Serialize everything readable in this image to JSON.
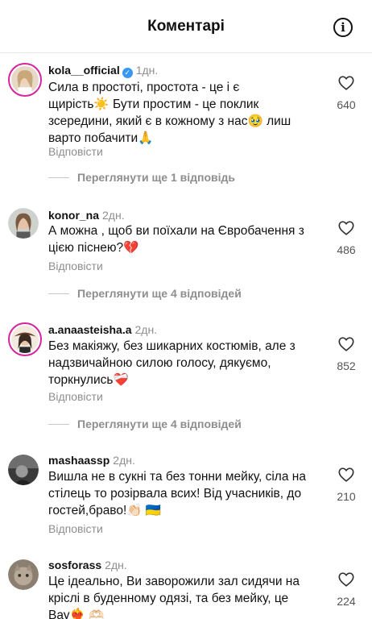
{
  "header": {
    "title": "Коментарі",
    "info_icon": "info-icon"
  },
  "comments": [
    {
      "username": "kola__official",
      "verified": true,
      "time": "1дн.",
      "lines": [
        "Сила в простоті, простота - це і є",
        "щирість☀️ Бути простим - це поклик",
        "зсередини, який є в кожному з нас🥹 лиш",
        "варто побачити🙏"
      ],
      "reply_label": "Відповісти",
      "likes": "640",
      "view_more": "Переглянути ще 1 відповідь"
    },
    {
      "username": "konor_na",
      "verified": false,
      "time": "2дн.",
      "lines": [
        "А можна , щоб ви поїхали на Євробачення з",
        "цією піснею?💔"
      ],
      "reply_label": "Відповісти",
      "likes": "486",
      "view_more": "Переглянути ще 4 відповідей"
    },
    {
      "username": "a.anaasteisha.a",
      "verified": false,
      "time": "2дн.",
      "lines": [
        "Без макіяжу, без шикарних костюмів, але з",
        "надзвичайною силою голосу, дякуємо,",
        "торкнулись❤️‍🩹"
      ],
      "reply_label": "Відповісти",
      "likes": "852",
      "view_more": "Переглянути ще 4 відповідей"
    },
    {
      "username": "mashaassp",
      "verified": false,
      "time": "2дн.",
      "lines": [
        "Вишла не в сукні та без тонни мейку, сіла на",
        "стілець то розірвала всих! Від учасників, до",
        "гостей,браво!👏🏻 🇺🇦"
      ],
      "reply_label": "Відповісти",
      "likes": "210"
    },
    {
      "username": "sosforass",
      "verified": false,
      "time": "2дн.",
      "lines": [
        "Це ідеально, Ви заворожили зал сидячи на",
        "кріслі в буденному одязі, та без мейку, це",
        "Вау❤️‍🔥 🫶🏻"
      ],
      "likes": "224"
    }
  ],
  "colors": {
    "accent_verified": "#3897f0",
    "muted": "#8e8e8e",
    "story_ring": "#d6249f"
  }
}
